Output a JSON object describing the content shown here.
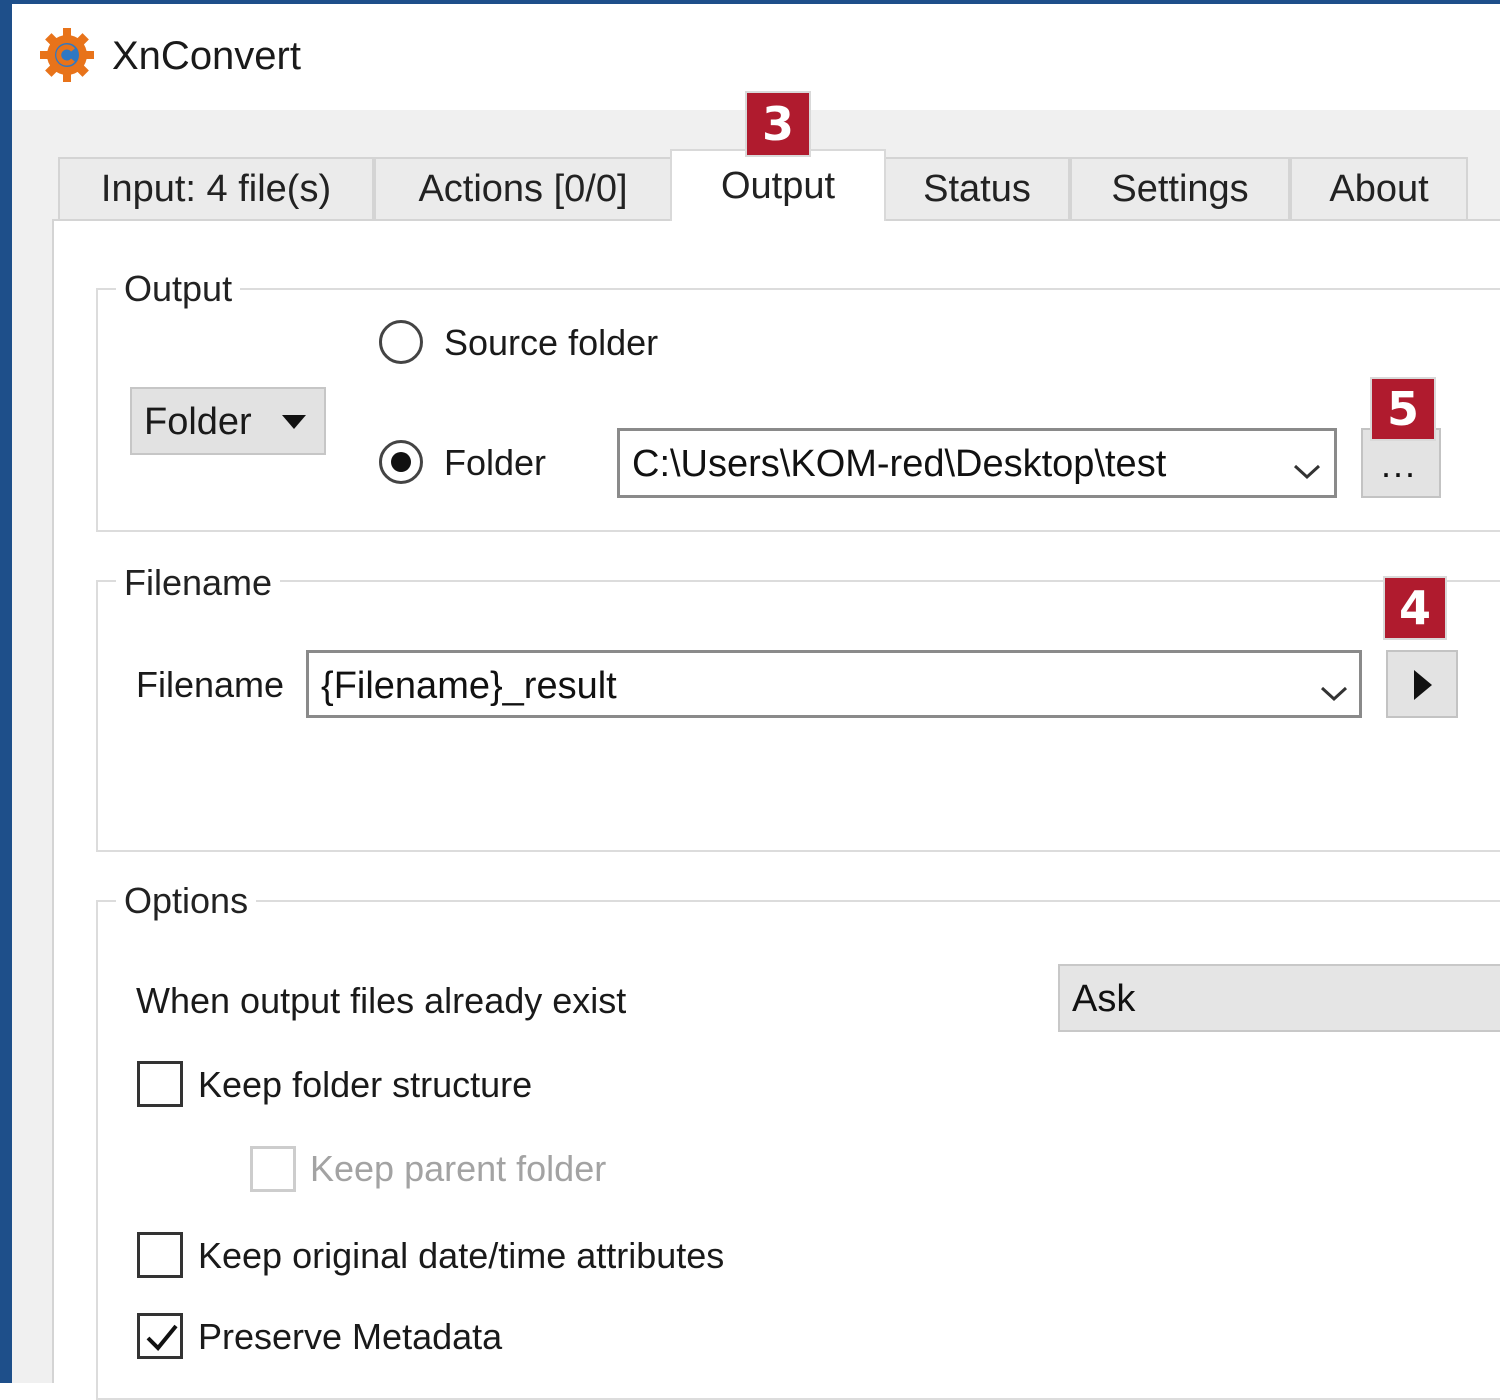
{
  "window": {
    "title": "XnConvert"
  },
  "tabs": [
    {
      "label": "Input: 4 file(s)"
    },
    {
      "label": "Actions [0/0]"
    },
    {
      "label": "Output",
      "active": true
    },
    {
      "label": "Status"
    },
    {
      "label": "Settings"
    },
    {
      "label": "About"
    }
  ],
  "callouts": {
    "output_tab": "3",
    "browse_button": "5",
    "filename_menu_button": "4"
  },
  "output_group": {
    "title": "Output",
    "destination_type": "Folder",
    "source_folder_label": "Source folder",
    "source_folder_selected": false,
    "folder_label": "Folder",
    "folder_selected": true,
    "folder_path": "C:\\Users\\KOM-red\\Desktop\\test",
    "browse_label": "..."
  },
  "filename_group": {
    "title": "Filename",
    "filename_label": "Filename",
    "filename_value": "{Filename}_result"
  },
  "options_group": {
    "title": "Options",
    "when_exists_label": "When output files already exist",
    "when_exists_value": "Ask",
    "keep_folder_structure": {
      "label": "Keep folder structure",
      "checked": false
    },
    "keep_parent_folder": {
      "label": "Keep parent folder",
      "checked": false,
      "enabled": false
    },
    "keep_original_date": {
      "label": "Keep original date/time attributes",
      "checked": false
    },
    "preserve_metadata": {
      "label": "Preserve Metadata",
      "checked": true
    }
  },
  "colors": {
    "window_border": "#1e4f8a",
    "callout_badge": "#b01b2e",
    "app_icon": "#e8731a"
  }
}
